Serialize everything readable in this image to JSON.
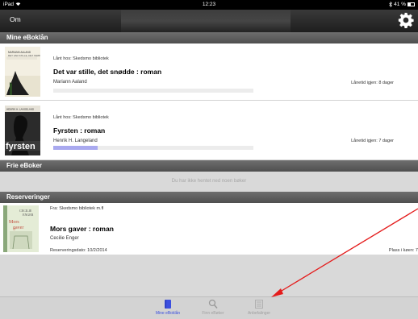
{
  "status_bar": {
    "device": "iPad",
    "time": "12:23",
    "battery": "41 %"
  },
  "nav": {
    "about_label": "Om",
    "settings_icon": "gear-icon"
  },
  "loans": {
    "header": "Mine eBoklån",
    "items": [
      {
        "library": "Lånt hos: Skedsmo bibliotek",
        "title": "Det var stille, det snødde : roman",
        "author": "Mariann Aaland",
        "due": "Lånetid igjen: 8 dager",
        "cover_text": "MARIANN AALAND\nDET VAR STILLE, DET SNØDDE",
        "progress": 0
      },
      {
        "library": "Lånt hos: Skedsmo bibliotek",
        "title": "Fyrsten : roman",
        "author": "Henrik H. Langeland",
        "due": "Lånetid igjen: 7 dager",
        "cover_text": "HENRIK H. LANGELAND\nfyrsten",
        "progress": 0.22
      }
    ]
  },
  "free": {
    "header": "Frie eBoker",
    "empty_message": "Du har ikke hentet ned noen bøker"
  },
  "reservations": {
    "header": "Reserveringer",
    "items": [
      {
        "library": "Fra: Skedsmo bibliotek m.fl",
        "title": "Mors gaver : roman",
        "author": "Cecilie Enger",
        "date": "Reserveringsdato: 10/2/2014",
        "queue": "Plass i køen: 7",
        "cover_text": "CECILIE\nENGER\nMors\ngaver"
      }
    ]
  },
  "tabs": [
    {
      "label": "Mine eBoklån",
      "icon": "book-icon",
      "active": true
    },
    {
      "label": "Finn eBøker",
      "icon": "search-icon",
      "active": false
    },
    {
      "label": "Anbefalinger",
      "icon": "list-icon",
      "active": false
    }
  ],
  "colors": {
    "accent": "#3b4fe0",
    "progress": "#a9a9ef",
    "annotation_arrow": "#e41b1b"
  }
}
